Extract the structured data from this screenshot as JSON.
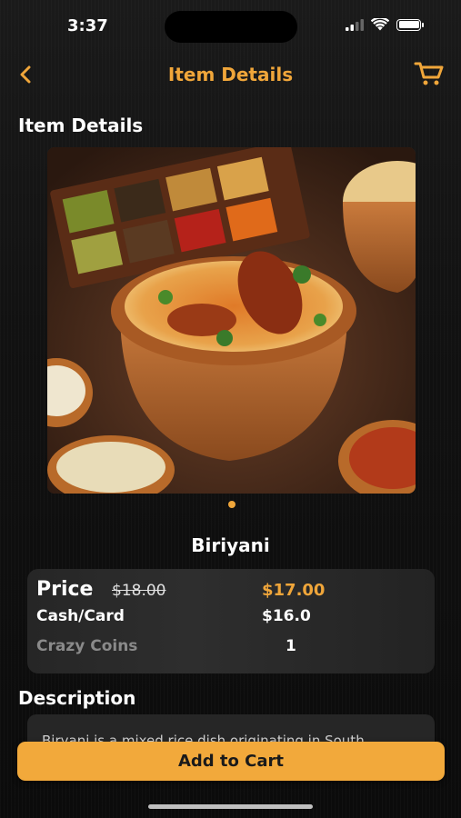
{
  "status_bar": {
    "time": "3:37"
  },
  "nav": {
    "title": "Item Details"
  },
  "section": {
    "heading": "Item Details"
  },
  "item": {
    "name": "Biriyani"
  },
  "pricing": {
    "price_label": "Price",
    "old_price": "$18.00",
    "new_price": "$17.00",
    "cash_label": "Cash/Card",
    "cash_value": "$16.0",
    "coins_label": "Crazy Coins",
    "coins_value": "1"
  },
  "description": {
    "heading": "Description",
    "text": "Biryani is a mixed rice dish originating in South"
  },
  "actions": {
    "add_to_cart_label": "Add to Cart"
  },
  "colors": {
    "accent": "#F0A63A",
    "button": "#F2A93B",
    "background": "#111111",
    "card": "#2a2a2a"
  },
  "icons": {
    "back": "chevron-left-icon",
    "cart": "cart-icon",
    "signal": "signal-icon",
    "wifi": "wifi-icon",
    "battery": "battery-icon"
  }
}
